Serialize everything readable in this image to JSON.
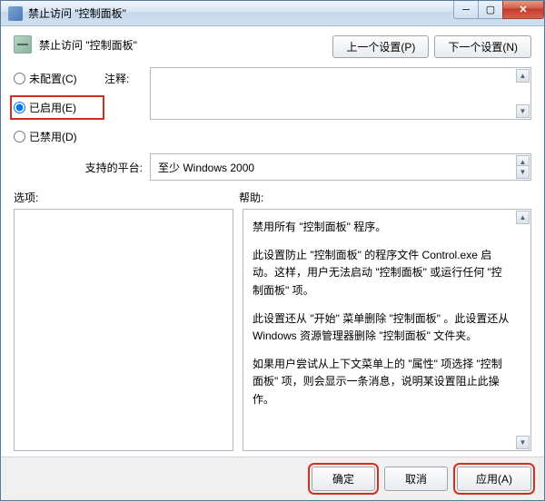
{
  "window": {
    "title": "禁止访问 \"控制面板\""
  },
  "header": {
    "title": "禁止访问 \"控制面板\""
  },
  "nav": {
    "prev": "上一个设置(P)",
    "next": "下一个设置(N)"
  },
  "radios": {
    "not_configured": "未配置(C)",
    "enabled": "已启用(E)",
    "disabled": "已禁用(D)"
  },
  "labels": {
    "comment": "注释:",
    "platform": "支持的平台:",
    "options": "选项:",
    "help": "帮助:"
  },
  "platform": {
    "value": "至少 Windows 2000"
  },
  "help": {
    "p1": "禁用所有 \"控制面板\" 程序。",
    "p2": "此设置防止 \"控制面板\" 的程序文件 Control.exe 启动。这样，用户无法启动 \"控制面板\" 或运行任何 \"控制面板\" 项。",
    "p3": "此设置还从 \"开始\" 菜单删除 \"控制面板\" 。此设置还从 Windows 资源管理器删除 \"控制面板\" 文件夹。",
    "p4": "如果用户尝试从上下文菜单上的 \"属性\" 项选择 \"控制面板\" 项，则会显示一条消息，说明某设置阻止此操作。"
  },
  "footer": {
    "ok": "确定",
    "cancel": "取消",
    "apply": "应用(A)"
  }
}
